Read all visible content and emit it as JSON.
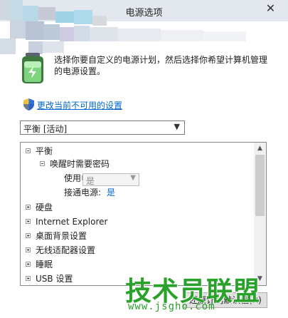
{
  "window": {
    "title": "电源选项",
    "close_symbol": "✕"
  },
  "header": {
    "description_line1": "选择你要自定义的电源计划，然后选择你希望计算机管理",
    "description_line2": "的电源设置。",
    "change_link": "更改当前不可用的设置"
  },
  "plan_select": {
    "value": "平衡 [活动]"
  },
  "tree": {
    "items": [
      {
        "label": "平衡",
        "state": "expanded"
      },
      {
        "label": "唤醒时需要密码",
        "state": "expanded"
      },
      {
        "label": "使用电池:"
      },
      {
        "label": "接通电源:",
        "value": "是"
      },
      {
        "label": "硬盘",
        "state": "collapsed"
      },
      {
        "label": "Internet Explorer",
        "state": "collapsed"
      },
      {
        "label": "桌面背景设置",
        "state": "collapsed"
      },
      {
        "label": "无线适配器设置",
        "state": "collapsed"
      },
      {
        "label": "睡眠",
        "state": "collapsed"
      },
      {
        "label": "USB 设置",
        "state": "collapsed"
      }
    ],
    "battery_select_value": "是"
  },
  "restore_button": {
    "label": "还原计划默认值(R)"
  },
  "watermark": {
    "cn": "技术员联盟",
    "url": "www.jsgho.com"
  },
  "colors": {
    "link": "#0066cc",
    "watermark": "#2aa12a"
  }
}
